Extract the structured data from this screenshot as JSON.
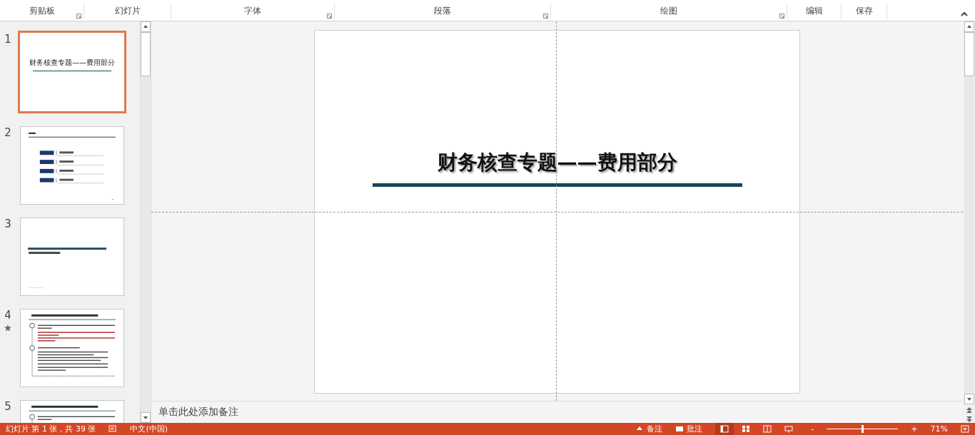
{
  "ribbon": {
    "groups": [
      {
        "label": "剪贴板",
        "launcher": true
      },
      {
        "label": "幻灯片",
        "launcher": false
      },
      {
        "label": "字体",
        "launcher": true
      },
      {
        "label": "段落",
        "launcher": true
      },
      {
        "label": "绘图",
        "launcher": true
      },
      {
        "label": "编辑",
        "launcher": false
      },
      {
        "label": "保存",
        "launcher": false
      }
    ]
  },
  "thumbnails": [
    {
      "number": "1",
      "selected": true,
      "kind": "title",
      "title": "财务核查专题——费用部分",
      "animated": false
    },
    {
      "number": "2",
      "selected": false,
      "kind": "agenda",
      "animated": false
    },
    {
      "number": "3",
      "selected": false,
      "kind": "section",
      "animated": false
    },
    {
      "number": "4",
      "selected": false,
      "kind": "text",
      "animated": true
    },
    {
      "number": "5",
      "selected": false,
      "kind": "text",
      "animated": false
    }
  ],
  "slide": {
    "title": "财务核查专题——费用部分"
  },
  "notes": {
    "placeholder": "单击此处添加备注"
  },
  "status_bar": {
    "slide_info": "幻灯片 第 1 张，共 39 张",
    "language": "中文(中国)",
    "notes": "备注",
    "comments": "批注",
    "zoom_out": "-",
    "zoom_slider": {
      "level": 0.5
    },
    "zoom_in": "+",
    "zoom": "71%"
  }
}
